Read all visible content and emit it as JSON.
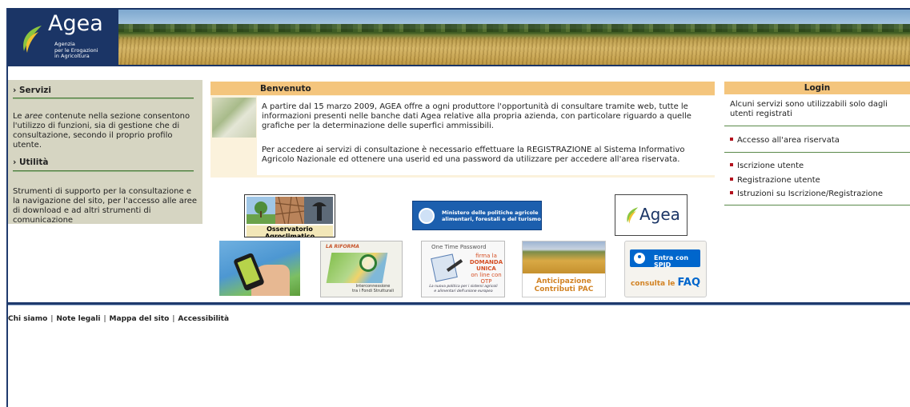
{
  "header": {
    "logo_word": "Agea",
    "logo_sub_1": "Agenzia",
    "logo_sub_2": "per le Erogazioni",
    "logo_sub_3": "in Agricoltura"
  },
  "left": {
    "servizi_title": "› Servizi",
    "servizi_text_pre": "Le ",
    "servizi_text_em": "aree",
    "servizi_text_post": " contenute nella sezione consentono l'utilizzo di funzioni, sia di gestione che di consultazione, secondo il proprio profilo utente.",
    "utilita_title": "› Utilità",
    "utilita_text": "Strumenti di supporto per la consultazione e la navigazione del sito, per l'accesso alle aree di download e ad altri strumenti di comunicazione"
  },
  "welcome": {
    "title": "Benvenuto",
    "para1": "A partire dal 15 marzo 2009, AGEA offre a ogni produttore l'opportunità di consultare tramite web, tutte le informazioni presenti nelle banche dati Agea relative alla propria azienda, con particolare riguardo a quelle grafiche per la determinazione delle superfici ammissibili.",
    "para2": "Per accedere ai servizi di consultazione è necessario effettuare la REGISTRAZIONE al Sistema Informativo Agricolo Nazionale ed ottenere una userid ed una password da utilizzare per accedere all'area riservata."
  },
  "logos": {
    "osservatorio": "Osservatorio Agroclimatico",
    "mipaaf_1": "Ministero delle politiche agricole",
    "mipaaf_2": "alimentari, forestali e del turismo",
    "agea": "Agea",
    "riforma_title": "LA RIFORMA",
    "riforma_cap_1": "Interconnessione",
    "riforma_cap_2": "tra i Fondi Strutturali",
    "otp_title": "One Time Password",
    "otp_1": "firma la",
    "otp_2": "DOMANDA",
    "otp_3": "UNICA",
    "otp_4": "on line con OTP",
    "otp_cap_1": "La nuova politica per i sistemi agricoli",
    "otp_cap_2": "e alimentari dell'unione europea",
    "pac_1": "Anticipazione",
    "pac_2": "Contributi PAC",
    "spid": "Entra con SPID",
    "faq_pre": "consulta le ",
    "faq_word": "FAQ"
  },
  "login": {
    "title": "Login",
    "desc": "Alcuni servizi sono utilizzabili solo dagli utenti registrati",
    "area_riservata": "Accesso all'area riservata",
    "iscrizione": "Iscrizione utente",
    "registrazione": "Registrazione utente",
    "istruzioni": "Istruzioni su Iscrizione/Registrazione"
  },
  "footer": {
    "chi_siamo": "Chi siamo",
    "note_legali": "Note legali",
    "mappa": "Mappa del sito",
    "accessibilita": "Accessibilità"
  }
}
